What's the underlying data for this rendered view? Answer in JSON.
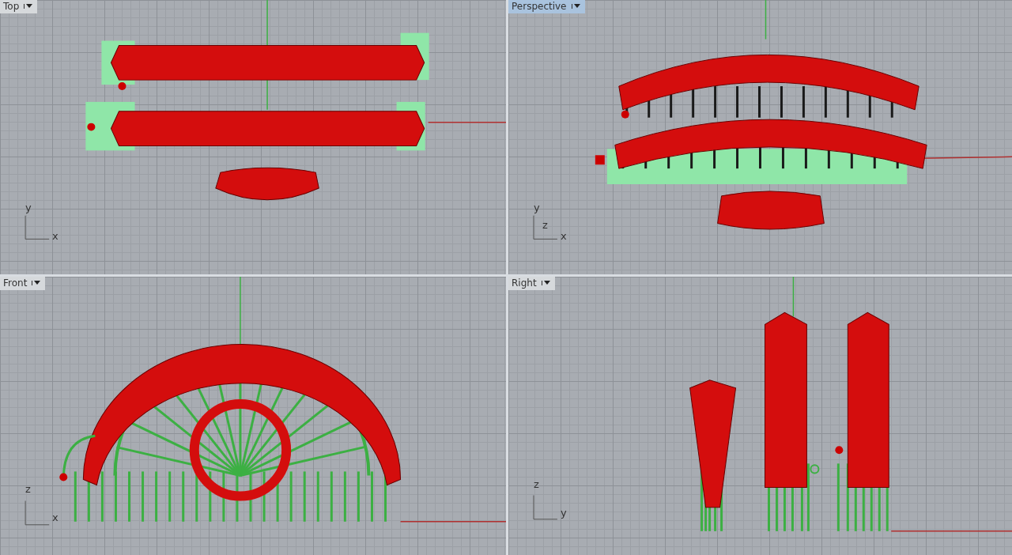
{
  "viewports": [
    {
      "kind": "top",
      "title": "Top",
      "selected": false,
      "axes": [
        "y",
        "x"
      ]
    },
    {
      "kind": "perspective",
      "title": "Perspective",
      "selected": true,
      "axes": [
        "y",
        "z",
        "x"
      ]
    },
    {
      "kind": "front",
      "title": "Front",
      "selected": false,
      "axes": [
        "z",
        "x"
      ]
    },
    {
      "kind": "right",
      "title": "Right",
      "selected": false,
      "axes": [
        "z",
        "y"
      ]
    }
  ]
}
